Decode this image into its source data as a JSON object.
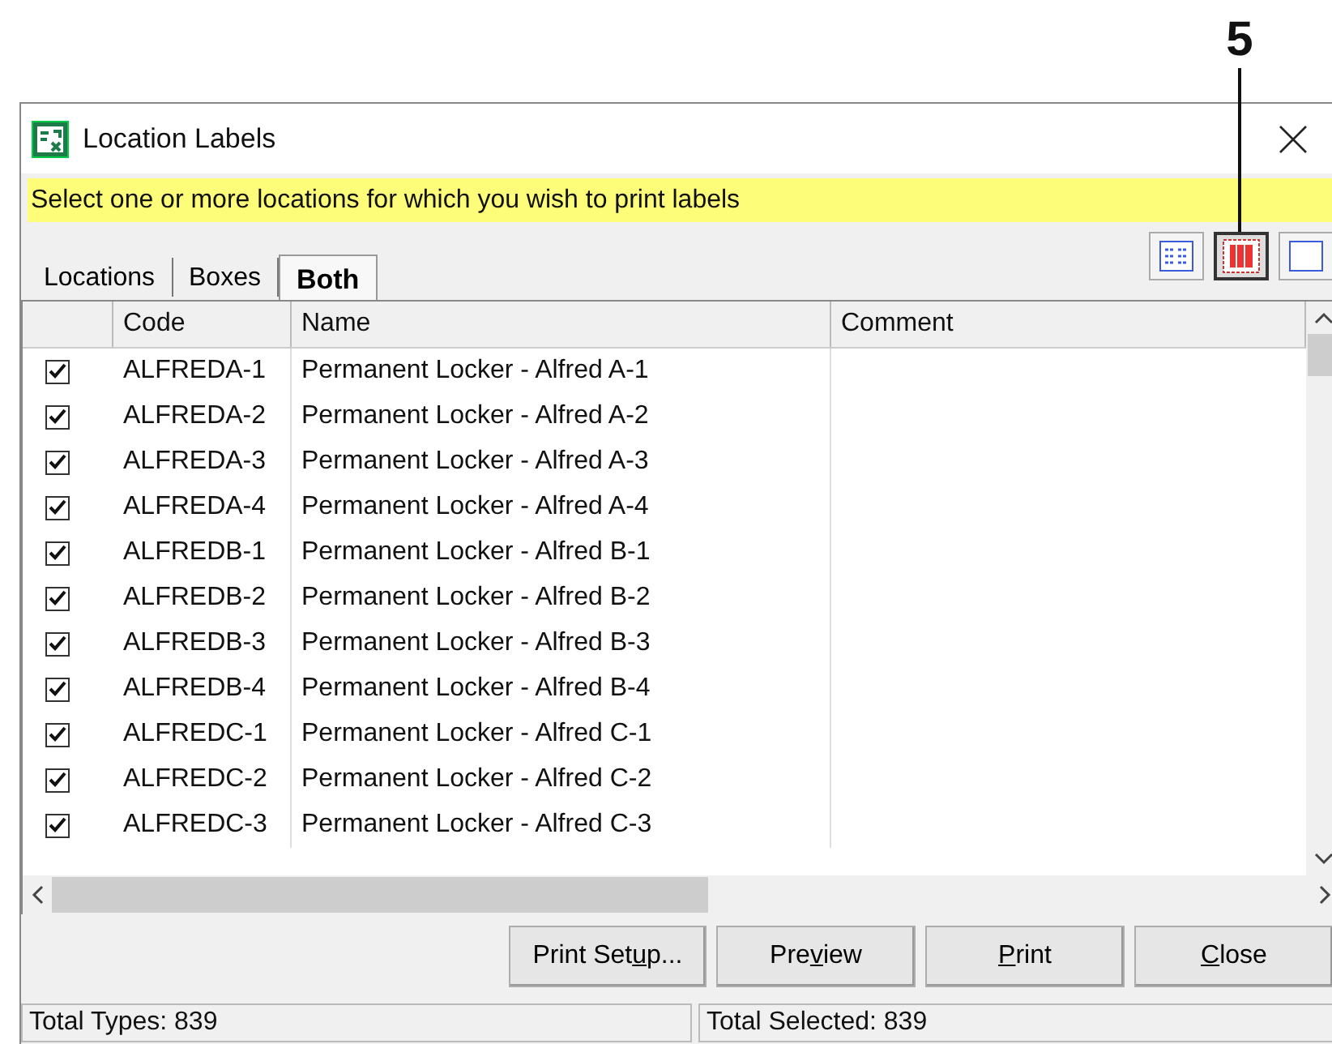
{
  "callout": {
    "label": "5"
  },
  "window": {
    "title": "Location Labels"
  },
  "instruction": "Select one or more locations for which you wish to print labels",
  "tabs": [
    {
      "label": "Locations",
      "selected": false
    },
    {
      "label": "Boxes",
      "selected": false
    },
    {
      "label": "Both",
      "selected": true
    }
  ],
  "view_buttons": [
    {
      "kind": "list",
      "selected": false
    },
    {
      "kind": "grid",
      "selected": true
    },
    {
      "kind": "blank",
      "selected": false
    }
  ],
  "table": {
    "columns": [
      "Code",
      "Name",
      "Comment"
    ],
    "rows": [
      {
        "checked": true,
        "code": "ALFREDA-1",
        "name": "Permanent Locker - Alfred A-1"
      },
      {
        "checked": true,
        "code": "ALFREDA-2",
        "name": "Permanent Locker - Alfred A-2"
      },
      {
        "checked": true,
        "code": "ALFREDA-3",
        "name": "Permanent Locker - Alfred A-3"
      },
      {
        "checked": true,
        "code": "ALFREDA-4",
        "name": "Permanent Locker - Alfred A-4"
      },
      {
        "checked": true,
        "code": "ALFREDB-1",
        "name": "Permanent Locker - Alfred B-1"
      },
      {
        "checked": true,
        "code": "ALFREDB-2",
        "name": "Permanent Locker - Alfred B-2"
      },
      {
        "checked": true,
        "code": "ALFREDB-3",
        "name": "Permanent Locker - Alfred B-3"
      },
      {
        "checked": true,
        "code": "ALFREDB-4",
        "name": "Permanent Locker - Alfred B-4"
      },
      {
        "checked": true,
        "code": "ALFREDC-1",
        "name": "Permanent Locker - Alfred C-1"
      },
      {
        "checked": true,
        "code": "ALFREDC-2",
        "name": "Permanent Locker - Alfred C-2"
      },
      {
        "checked": true,
        "code": "ALFREDC-3",
        "name": "Permanent Locker - Alfred C-3"
      }
    ]
  },
  "buttons": [
    {
      "before": "Print Set",
      "key": "u",
      "after": "p..."
    },
    {
      "before": "Pre",
      "key": "v",
      "after": "iew"
    },
    {
      "key": "P",
      "after": "rint"
    },
    {
      "key": "C",
      "after": "lose"
    }
  ],
  "status_bar": [
    "Total Types: 839",
    "Total Selected: 839"
  ]
}
